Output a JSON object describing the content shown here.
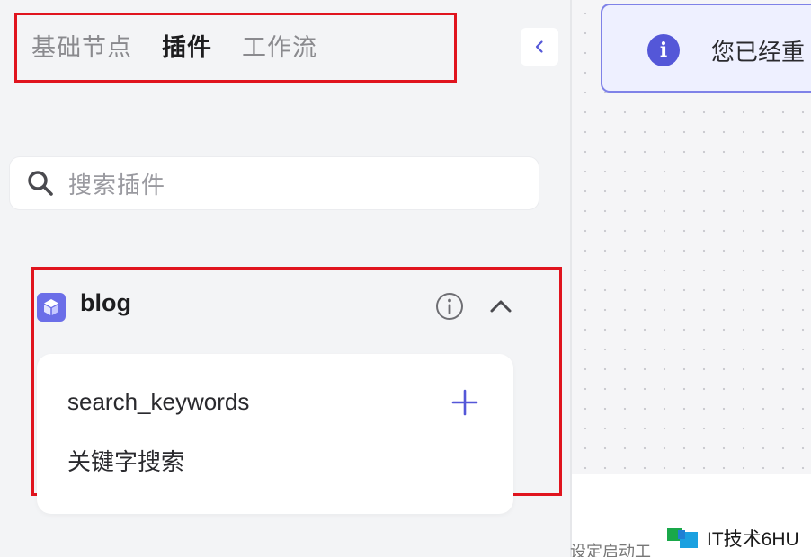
{
  "tabs": [
    {
      "label": "基础节点",
      "active": false
    },
    {
      "label": "插件",
      "active": true
    },
    {
      "label": "工作流",
      "active": false
    }
  ],
  "search": {
    "placeholder": "搜索插件"
  },
  "plugin": {
    "name": "blog",
    "tools": [
      {
        "name": "search_keywords",
        "description": "关键字搜索"
      }
    ]
  },
  "notice": {
    "text": "您已经重"
  },
  "footer": {
    "text": "设定启动工"
  },
  "watermark": {
    "text": "IT技术6HU"
  },
  "colors": {
    "highlight": "#e0141e",
    "accent": "#5457d8",
    "plugin_logo": "#6b6ee8"
  },
  "icons": {
    "collapse": "chevron-left-icon",
    "search": "search-icon",
    "plugin_logo": "cube-icon",
    "info": "info-icon",
    "collapse_plugin": "chevron-up-icon",
    "add": "plus-icon",
    "notice": "info-filled-icon"
  }
}
